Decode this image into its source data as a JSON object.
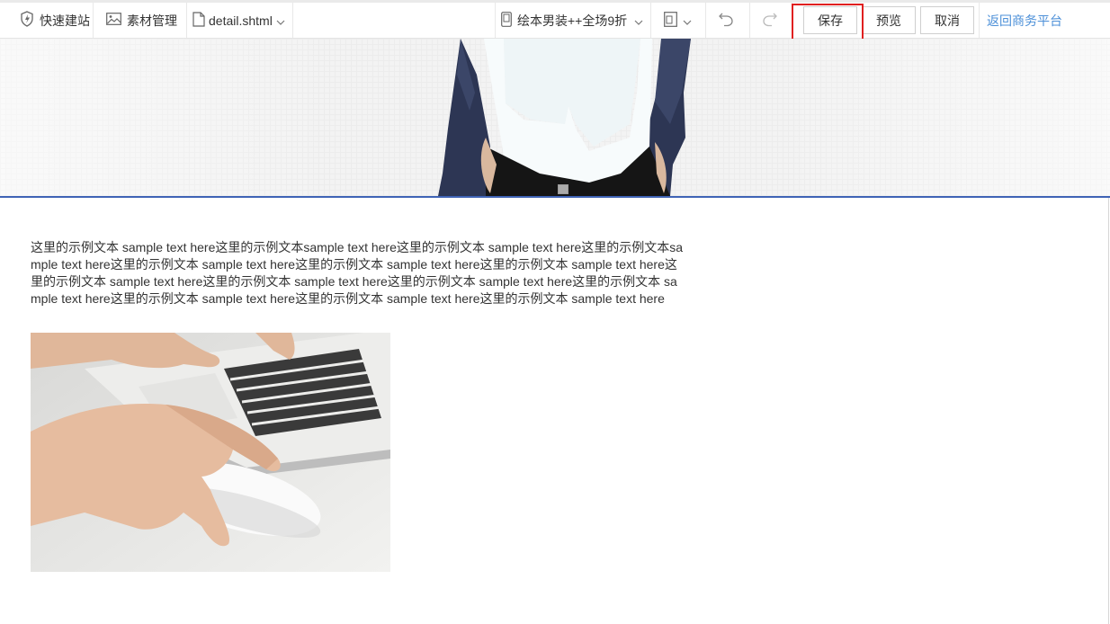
{
  "toolbar": {
    "quick_build": "快速建站",
    "material_manage": "素材管理",
    "file_name": "detail.shtml",
    "page_selector": "绘本男装++全场9折",
    "save": "保存",
    "preview": "预览",
    "cancel": "取消",
    "back_link": "返回商务平台"
  },
  "icons": {
    "quick_build": "lightning-shield-icon",
    "material": "image-icon",
    "file": "file-icon",
    "page": "mobile-page-icon",
    "device": "device-icon",
    "undo": "undo-icon",
    "redo": "redo-icon",
    "chevron": "chevron-down-icon"
  },
  "colors": {
    "link": "#4b8fd8",
    "highlight": "#e02020",
    "banner_line": "#3f63b5"
  },
  "content": {
    "paragraph": "这里的示例文本 sample text here这里的示例文本sample text here这里的示例文本 sample text here这里的示例文本sample text here这里的示例文本 sample text here这里的示例文本 sample text here这里的示例文本 sample text here这里的示例文本 sample text here这里的示例文本 sample text here这里的示例文本 sample text here这里的示例文本 sample text here这里的示例文本 sample text here这里的示例文本 sample text here这里的示例文本 sample text here"
  }
}
